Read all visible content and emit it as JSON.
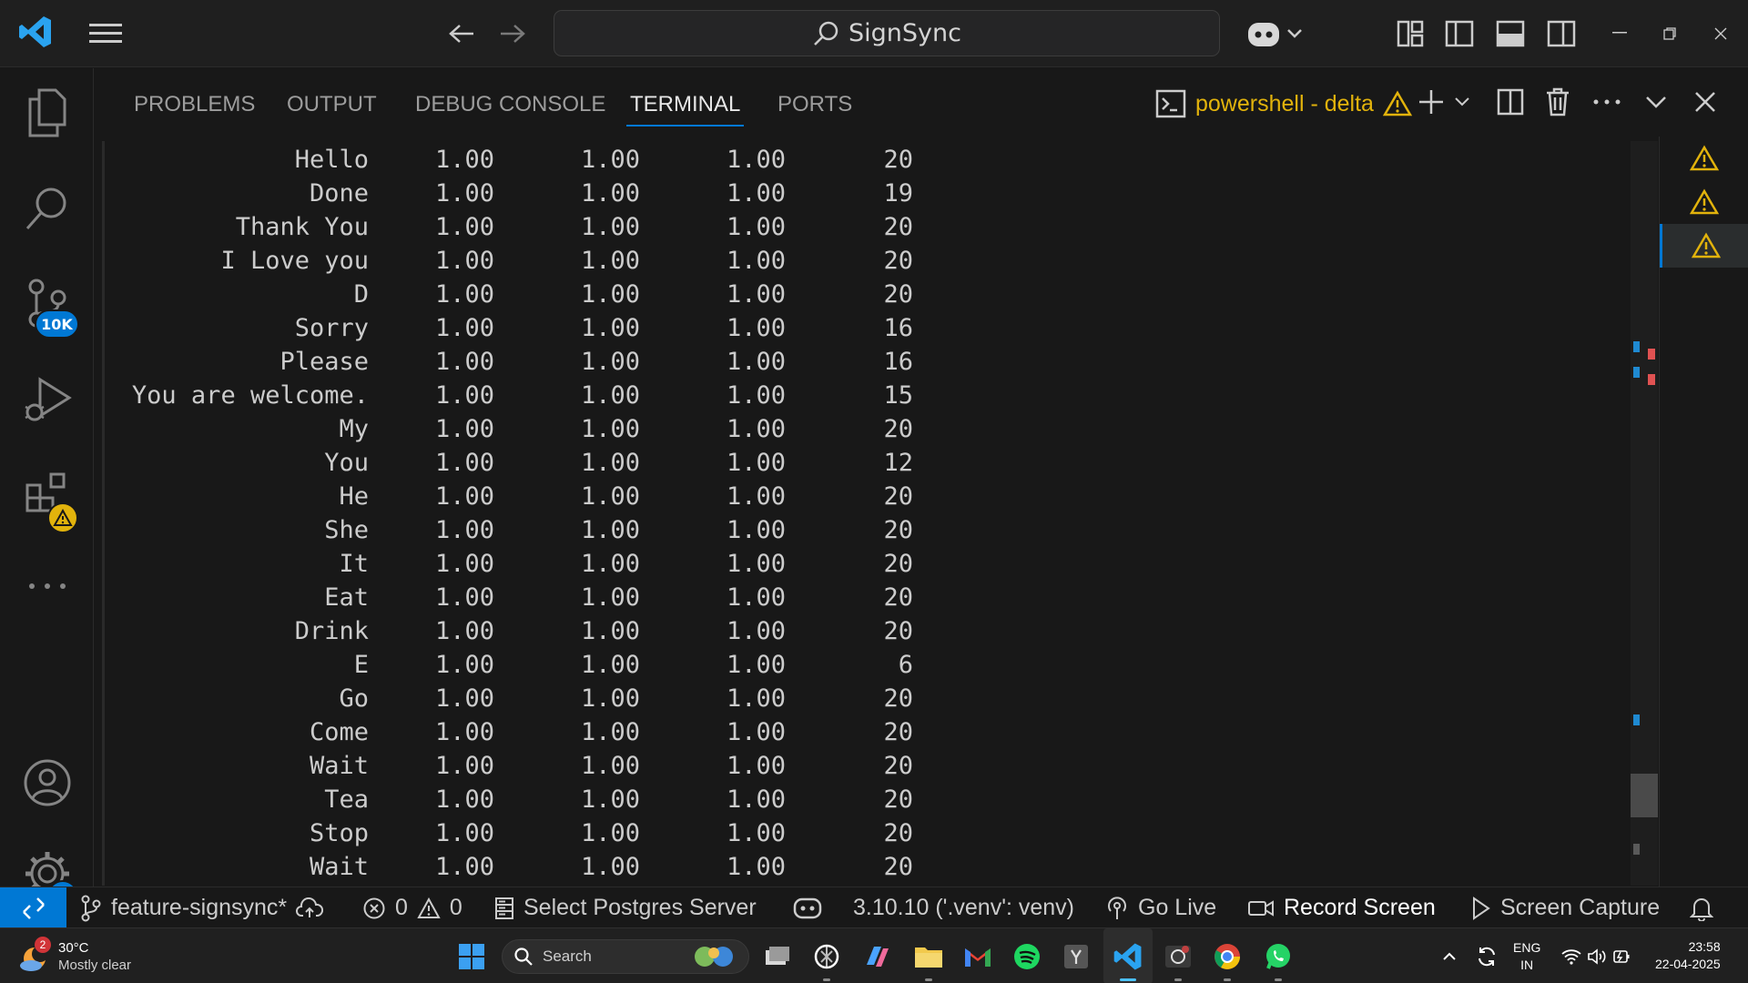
{
  "titlebar": {
    "search_text": "SignSync"
  },
  "activity": {
    "scm_badge": "10K",
    "settings_badge": "1"
  },
  "panel": {
    "tabs": [
      "PROBLEMS",
      "OUTPUT",
      "DEBUG CONSOLE",
      "TERMINAL",
      "PORTS"
    ],
    "active_tab": "TERMINAL",
    "terminal_name": "powershell - delta"
  },
  "terminal": {
    "rows": [
      [
        "Hello",
        "1.00",
        "1.00",
        "1.00",
        "20"
      ],
      [
        "Done",
        "1.00",
        "1.00",
        "1.00",
        "19"
      ],
      [
        "Thank You",
        "1.00",
        "1.00",
        "1.00",
        "20"
      ],
      [
        "I Love you",
        "1.00",
        "1.00",
        "1.00",
        "20"
      ],
      [
        "D",
        "1.00",
        "1.00",
        "1.00",
        "20"
      ],
      [
        "Sorry",
        "1.00",
        "1.00",
        "1.00",
        "16"
      ],
      [
        "Please",
        "1.00",
        "1.00",
        "1.00",
        "16"
      ],
      [
        "You are welcome.",
        "1.00",
        "1.00",
        "1.00",
        "15"
      ],
      [
        "My",
        "1.00",
        "1.00",
        "1.00",
        "20"
      ],
      [
        "You",
        "1.00",
        "1.00",
        "1.00",
        "12"
      ],
      [
        "He",
        "1.00",
        "1.00",
        "1.00",
        "20"
      ],
      [
        "She",
        "1.00",
        "1.00",
        "1.00",
        "20"
      ],
      [
        "It",
        "1.00",
        "1.00",
        "1.00",
        "20"
      ],
      [
        "Eat",
        "1.00",
        "1.00",
        "1.00",
        "20"
      ],
      [
        "Drink",
        "1.00",
        "1.00",
        "1.00",
        "20"
      ],
      [
        "E",
        "1.00",
        "1.00",
        "1.00",
        "6"
      ],
      [
        "Go",
        "1.00",
        "1.00",
        "1.00",
        "20"
      ],
      [
        "Come",
        "1.00",
        "1.00",
        "1.00",
        "20"
      ],
      [
        "Wait",
        "1.00",
        "1.00",
        "1.00",
        "20"
      ],
      [
        "Tea",
        "1.00",
        "1.00",
        "1.00",
        "20"
      ],
      [
        "Stop",
        "1.00",
        "1.00",
        "1.00",
        "20"
      ],
      [
        "Wait",
        "1.00",
        "1.00",
        "1.00",
        "20"
      ]
    ]
  },
  "statusbar": {
    "branch": "feature-signsync*",
    "errors": "0",
    "warnings": "0",
    "postgres": "Select Postgres Server",
    "python": "3.10.10 ('.venv': venv)",
    "golive": "Go Live",
    "record": "Record Screen",
    "capture": "Screen Capture"
  },
  "taskbar": {
    "weather_badge": "2",
    "temperature": "30°C",
    "weather_desc": "Mostly clear",
    "search_placeholder": "Search",
    "lang_line1": "ENG",
    "lang_line2": "IN",
    "time": "23:58",
    "date": "22-04-2025"
  },
  "colors": {
    "accent": "#0078d4",
    "warning": "#e2b30c",
    "terminal_title": "#e2b30c"
  }
}
